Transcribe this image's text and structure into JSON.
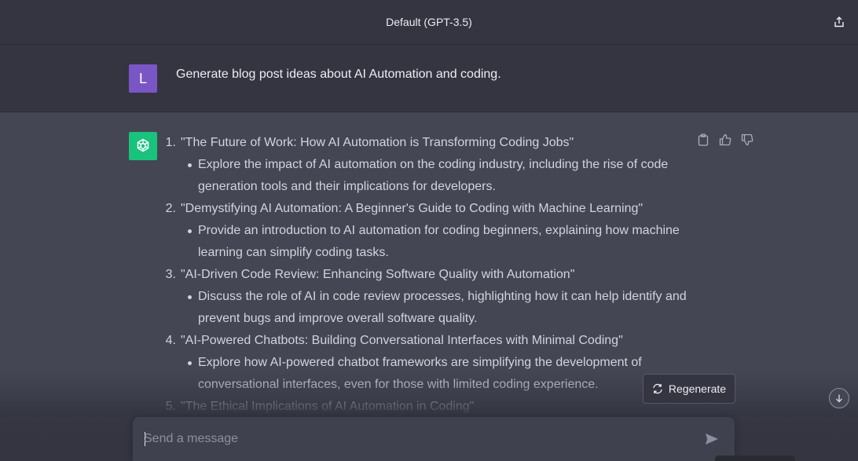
{
  "header": {
    "title": "Default (GPT-3.5)",
    "share_icon": "share-icon"
  },
  "user_message": {
    "avatar_letter": "L",
    "text": "Generate blog post ideas about AI Automation and coding."
  },
  "assistant_message": {
    "items": [
      {
        "number": "1.",
        "title": "\"The Future of Work: How AI Automation is Transforming Coding Jobs\"",
        "bullet": [
          "Explore the impact of AI automation on the coding industry, including the rise of code",
          "generation tools and their implications for developers."
        ]
      },
      {
        "number": "2.",
        "title": "\"Demystifying AI Automation: A Beginner's Guide to Coding with Machine Learning\"",
        "bullet": [
          "Provide an introduction to AI automation for coding beginners, explaining how machine",
          "learning can simplify coding tasks."
        ]
      },
      {
        "number": "3.",
        "title": "\"AI-Driven Code Review: Enhancing Software Quality with Automation\"",
        "bullet": [
          "Discuss the role of AI in code review processes, highlighting how it can help identify and",
          "prevent bugs and improve overall software quality."
        ]
      },
      {
        "number": "4.",
        "title": "\"AI-Powered Chatbots: Building Conversational Interfaces with Minimal Coding\"",
        "bullet": [
          "Explore how AI-powered chatbot frameworks are simplifying the development of",
          "conversational interfaces, even for those with limited coding experience."
        ]
      },
      {
        "number": "5.",
        "title": "\"The Ethical Implications of AI Automation in Coding\""
      }
    ],
    "action_icons": [
      "clipboard-icon",
      "thumbs-up-icon",
      "thumbs-down-icon"
    ]
  },
  "regenerate": {
    "label": "Regenerate"
  },
  "composer": {
    "placeholder": "Send a message"
  },
  "colors": {
    "assistant_bg": "#444654",
    "user_bg": "#343541",
    "bot_avatar": "#19c37d",
    "user_avatar": "#7a55c4"
  }
}
